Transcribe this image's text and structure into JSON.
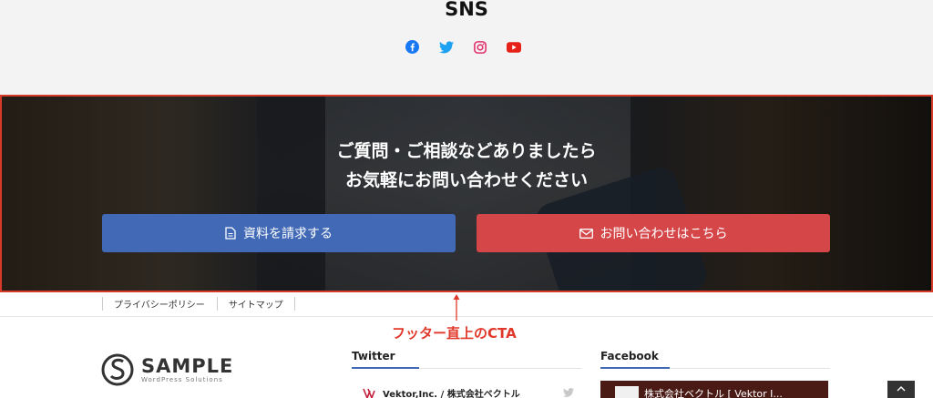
{
  "sns": {
    "title": "SNS",
    "icons": [
      "facebook-icon",
      "twitter-icon",
      "instagram-icon",
      "youtube-icon"
    ],
    "colors": {
      "facebook": "#1877f2",
      "twitter": "#1da1f2",
      "instagram": "#e1306c",
      "youtube": "#e62117"
    }
  },
  "cta": {
    "heading_line1": "ご質問・ご相談などありましたら",
    "heading_line2": "お気軽にお問い合わせください",
    "docs_button": "資料を請求する",
    "contact_button": "お問い合わせはこちら",
    "colors": {
      "docs": "#4169b6",
      "contact": "#d54649",
      "highlight_border": "#d63b2a"
    }
  },
  "annotation": {
    "label": "フッター直上のCTA",
    "color": "#e0392b"
  },
  "footer_nav": {
    "items": [
      "プライバシーポリシー",
      "サイトマップ"
    ]
  },
  "logo": {
    "name": "SAMPLE",
    "tagline": "WordPress Solutions"
  },
  "twitter_widget": {
    "title": "Twitter",
    "account": "Vektor,Inc. / 株式会社ベクトル"
  },
  "facebook_widget": {
    "title": "Facebook",
    "page_name": "株式会社ベクトル [ Vektor I..."
  }
}
